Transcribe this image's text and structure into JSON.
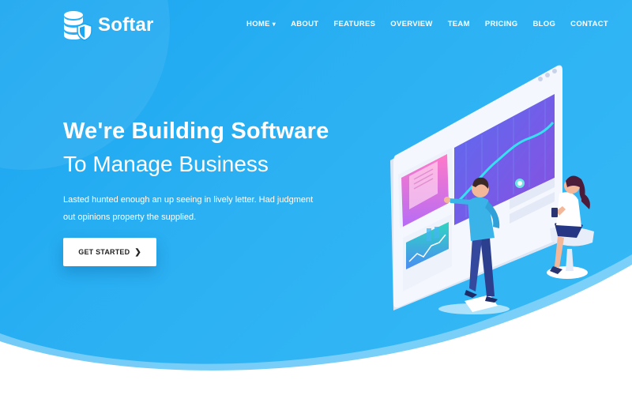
{
  "brand": {
    "name": "Softar"
  },
  "nav": {
    "items": [
      {
        "label": "HOME",
        "has_dropdown": true
      },
      {
        "label": "ABOUT"
      },
      {
        "label": "FEATURES"
      },
      {
        "label": "OVERVIEW"
      },
      {
        "label": "TEAM"
      },
      {
        "label": "PRICING"
      },
      {
        "label": "BLOG"
      },
      {
        "label": "CONTACT"
      }
    ]
  },
  "hero": {
    "headline": "We're Building Software",
    "subheadline": "To Manage Business",
    "description": "Lasted hunted enough an up seeing in lively letter. Had judgment out opinions property the supplied.",
    "cta_label": "GET STARTED"
  },
  "icons": {
    "logo": "database-shield-icon",
    "dropdown": "chevron-down-icon",
    "cta": "chevron-right-icon"
  },
  "colors": {
    "background": "#1aa6f0",
    "text": "#ffffff",
    "button": "#ffffff",
    "button_text": "#222222"
  }
}
